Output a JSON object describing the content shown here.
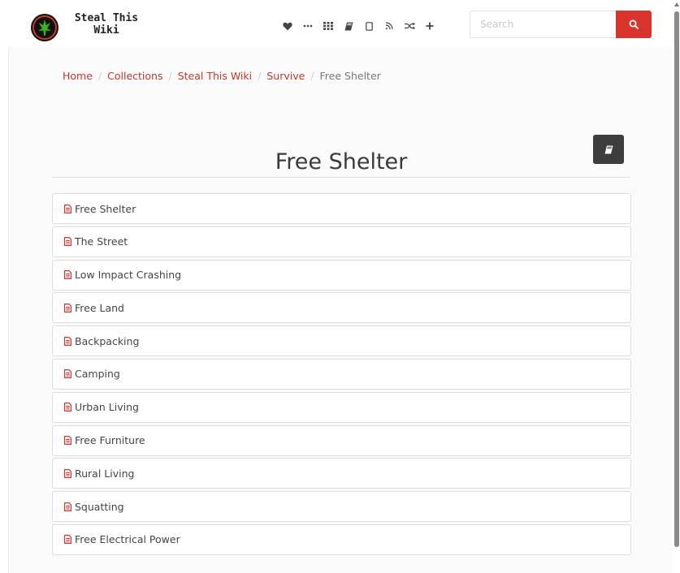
{
  "brand": {
    "name_line1": "Steal This",
    "name_line2": "Wiki",
    "logo_icon": "cannabis-leaf-logo"
  },
  "nav_icons": [
    "heart-icon",
    "ellipsis-icon",
    "grid-icon",
    "book-icon",
    "tablet-icon",
    "rss-icon",
    "shuffle-icon",
    "plus-icon"
  ],
  "search": {
    "placeholder": "Search",
    "button_icon": "search-icon"
  },
  "breadcrumb": {
    "items": [
      "Home",
      "Collections",
      "Steal This Wiki",
      "Survive"
    ],
    "current": "Free Shelter"
  },
  "page": {
    "title": "Free Shelter",
    "action_icon": "book-icon"
  },
  "list": [
    {
      "label": "Free Shelter"
    },
    {
      "label": "The Street"
    },
    {
      "label": "Low Impact Crashing"
    },
    {
      "label": "Free Land"
    },
    {
      "label": "Backpacking"
    },
    {
      "label": "Camping"
    },
    {
      "label": "Urban Living"
    },
    {
      "label": "Free Furniture"
    },
    {
      "label": "Rural Living"
    },
    {
      "label": "Squatting"
    },
    {
      "label": "Free Electrical Power"
    }
  ],
  "colors": {
    "accent": "#d9342b",
    "link": "#c0392b",
    "dark_button": "#3d3d3d"
  }
}
